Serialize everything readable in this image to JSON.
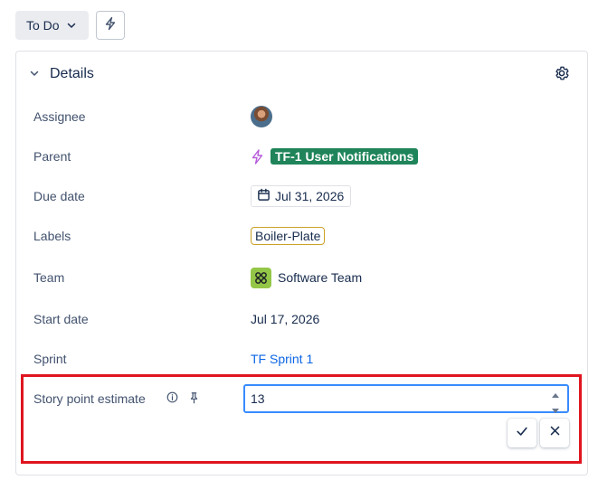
{
  "toolbar": {
    "status_label": "To Do",
    "status_icon": "chevron-down-icon",
    "automation_icon": "lightning-icon"
  },
  "details": {
    "title": "Details",
    "settings_icon": "gear-icon",
    "fields": {
      "assignee": {
        "label": "Assignee"
      },
      "parent": {
        "label": "Parent",
        "value": "TF-1 User Notifications",
        "color": "#1f845a"
      },
      "due_date": {
        "label": "Due date",
        "value": "Jul 31, 2026"
      },
      "labels": {
        "label": "Labels",
        "value": "Boiler-Plate"
      },
      "team": {
        "label": "Team",
        "value": "Software Team",
        "icon_color": "#94c748"
      },
      "start_date": {
        "label": "Start date",
        "value": "Jul 17, 2026"
      },
      "sprint": {
        "label": "Sprint",
        "value": "TF Sprint 1"
      },
      "story_points": {
        "label": "Story point estimate",
        "value": "13"
      }
    }
  },
  "colors": {
    "accent": "#0c66e4",
    "highlight": "#e0151f",
    "focus": "#388bff"
  }
}
